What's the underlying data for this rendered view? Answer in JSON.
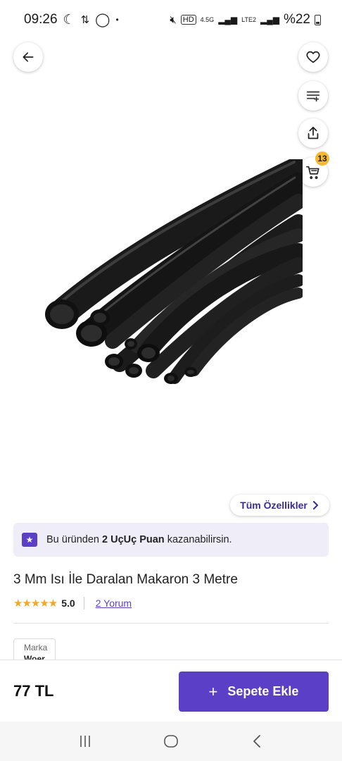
{
  "status_bar": {
    "time": "09:26",
    "battery": "%22",
    "network": "4.5G",
    "lte": "LTE2"
  },
  "icons": {
    "back": "arrow-left-icon",
    "favorite": "heart-icon",
    "list": "add-to-list-icon",
    "share": "share-icon",
    "cart": "cart-icon"
  },
  "cart": {
    "count": "13"
  },
  "features": {
    "label": "Tüm Özellikler"
  },
  "points": {
    "prefix": "Bu üründen",
    "highlight": "2 UçUç Puan",
    "suffix": "kazanabilirsin."
  },
  "product": {
    "title": "3 Mm Isı İle Daralan Makaron 3 Metre",
    "rating": "5.0",
    "stars": "★★★★★",
    "reviews": "2 Yorum"
  },
  "brand": {
    "label": "Marka",
    "value": "Woer"
  },
  "bottom": {
    "price": "77 TL",
    "add_to_cart": "Sepete Ekle"
  },
  "colors": {
    "primary": "#5b3fc7",
    "badge": "#f5b82e",
    "star": "#f5a623"
  }
}
